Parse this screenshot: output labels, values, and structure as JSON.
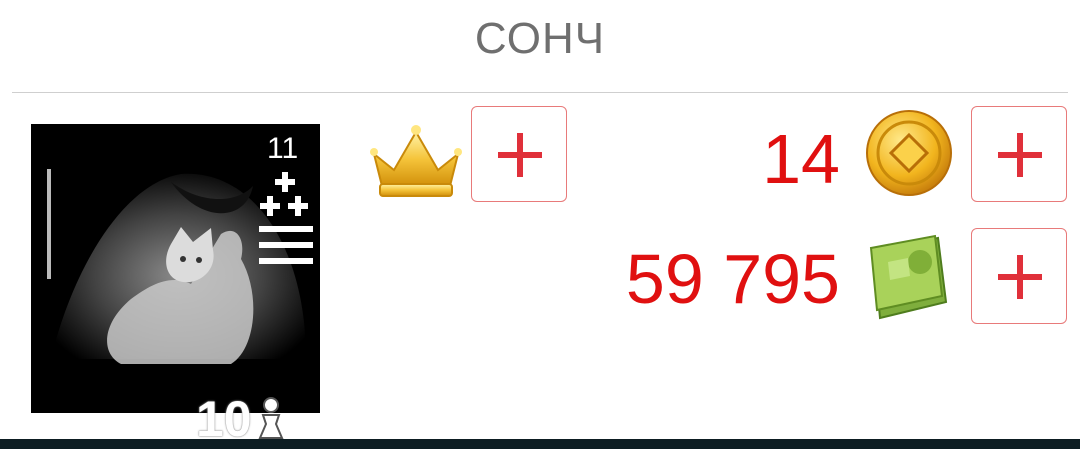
{
  "header": {
    "title": "СОНЧ"
  },
  "profile": {
    "avatar_overlay": {
      "top_number": "11"
    },
    "level": "10",
    "level_icon": "pawn-icon"
  },
  "premium": {
    "icon": "crown-icon"
  },
  "currencies": {
    "coins": {
      "value": "14",
      "icon": "gold-coin-icon"
    },
    "cash": {
      "value": "59 795",
      "icon": "money-stack-icon"
    }
  },
  "colors": {
    "value_text": "#e01010",
    "plus_sign": "#e0303a",
    "plus_border": "#e87a7a",
    "title_text": "#6f6f6f",
    "bottom_bar": "#0d1d22"
  }
}
